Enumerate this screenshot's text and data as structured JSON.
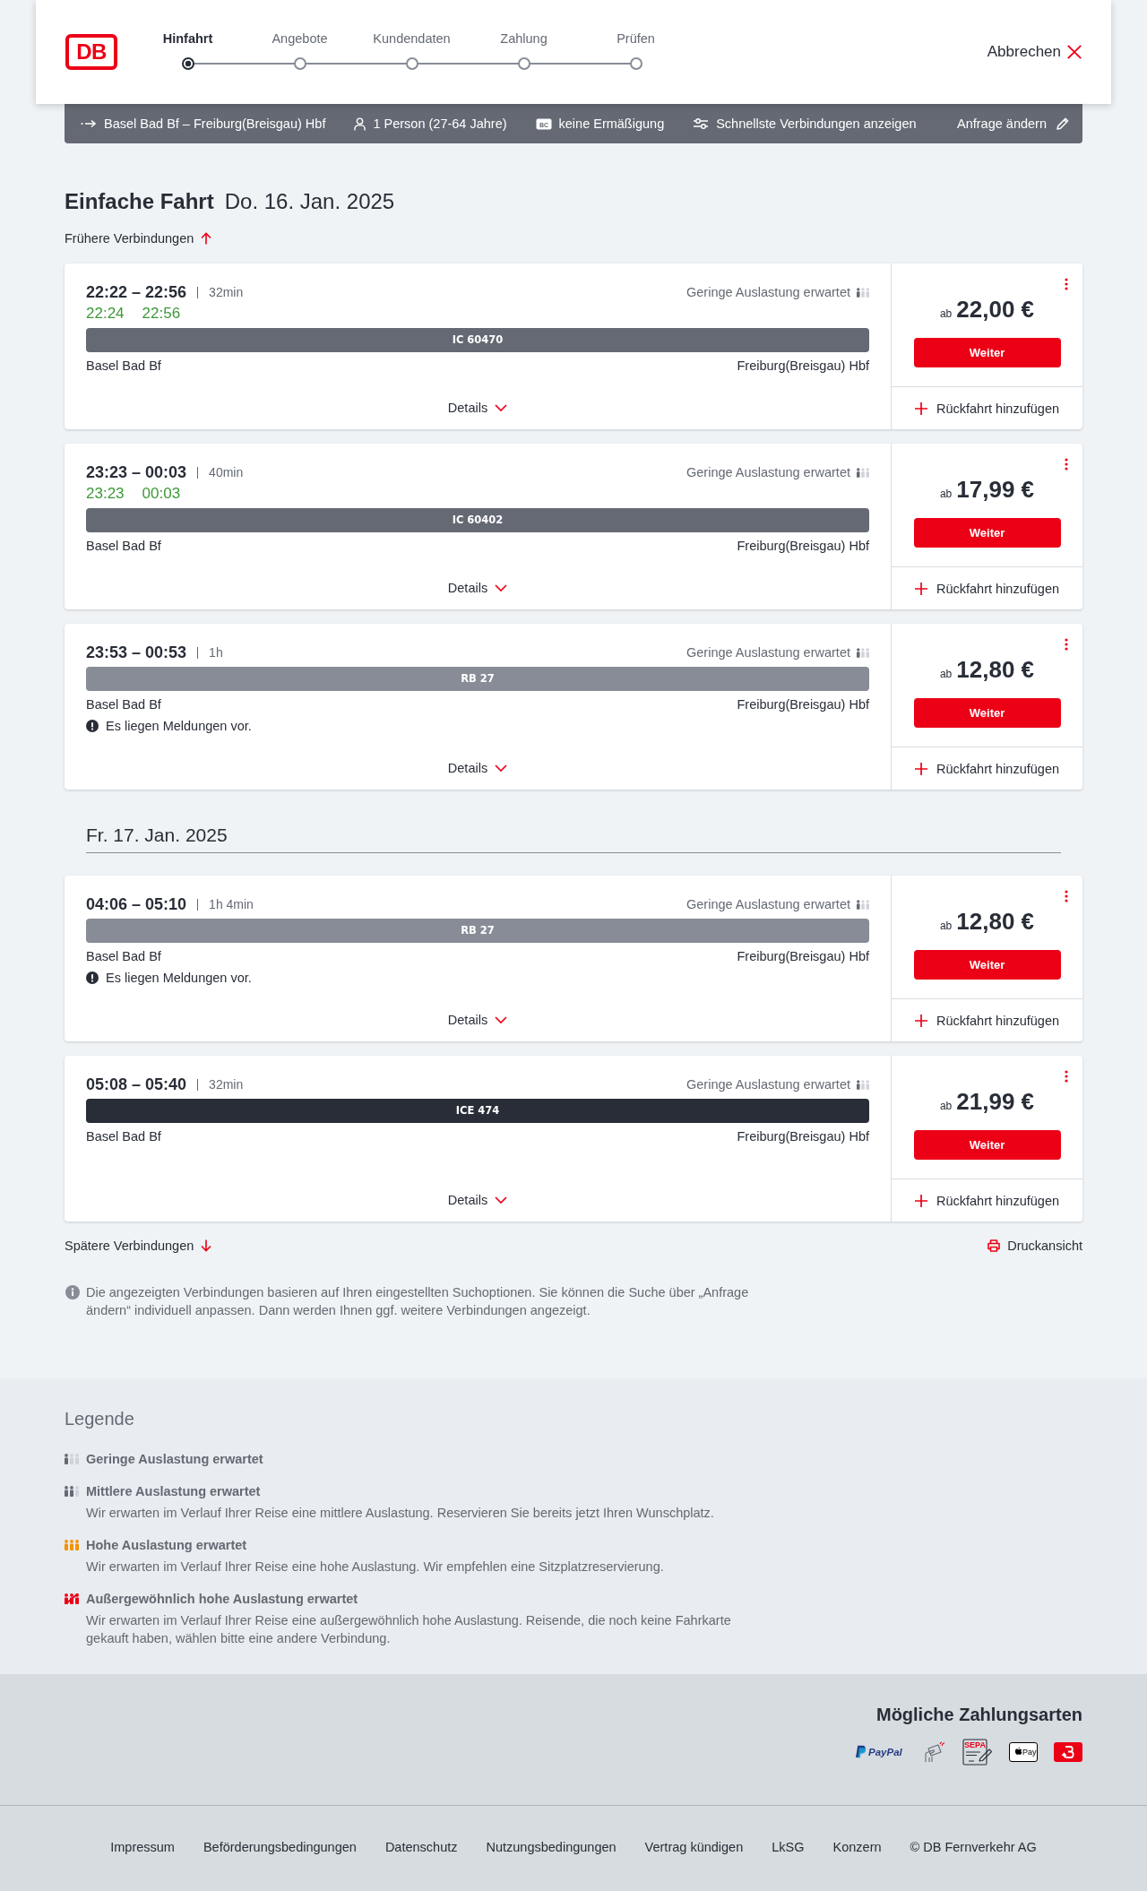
{
  "header": {
    "logo": "DB",
    "steps": [
      {
        "label": "Hinfahrt",
        "selected": true
      },
      {
        "label": "Angebote",
        "selected": false
      },
      {
        "label": "Kundendaten",
        "selected": false
      },
      {
        "label": "Zahlung",
        "selected": false
      },
      {
        "label": "Prüfen",
        "selected": false
      }
    ],
    "cancel": "Abbrechen"
  },
  "summary_bar": {
    "items": [
      {
        "kind": "route",
        "label": "Basel Bad Bf – Freiburg(Breisgau) Hbf"
      },
      {
        "kind": "person",
        "label": "1 Person (27-64 Jahre)"
      },
      {
        "kind": "card",
        "icon_label": "BC",
        "label": "keine Ermäßigung"
      },
      {
        "kind": "filter",
        "label": "Schnellste Verbindungen anzeigen"
      }
    ],
    "edit": "Anfrage ändern"
  },
  "title": {
    "trip_type": "Einfache Fahrt",
    "date": "Do. 16. Jan. 2025"
  },
  "earlier_link": "Frühere Verbindungen",
  "connection_groups": [
    {
      "connections": [
        {
          "times": "22:22 – 22:56",
          "duration": "32min",
          "realtime": {
            "departure": "22:24",
            "arrival": "22:56"
          },
          "occupancy": {
            "label": "Geringe Auslastung erwartet",
            "kind": "low"
          },
          "train": {
            "name": "IC 60470",
            "color": "#646973"
          },
          "from": "Basel Bad Bf",
          "to": "Freiburg(Breisgau) Hbf",
          "details": "Details",
          "price_prefix": "ab",
          "price": "22,00 €",
          "button": "Weiter",
          "return": "Rückfahrt hinzufügen"
        },
        {
          "times": "23:23 – 00:03",
          "duration": "40min",
          "realtime": {
            "departure": "23:23",
            "arrival": "00:03"
          },
          "occupancy": {
            "label": "Geringe Auslastung erwartet",
            "kind": "low"
          },
          "train": {
            "name": "IC 60402",
            "color": "#646973"
          },
          "from": "Basel Bad Bf",
          "to": "Freiburg(Breisgau) Hbf",
          "details": "Details",
          "price_prefix": "ab",
          "price": "17,99 €",
          "button": "Weiter",
          "return": "Rückfahrt hinzufügen"
        },
        {
          "times": "23:53 – 00:53",
          "duration": "1h",
          "occupancy": {
            "label": "Geringe Auslastung erwartet",
            "kind": "low"
          },
          "train": {
            "name": "RB 27",
            "color": "#878c96"
          },
          "from": "Basel Bad Bf",
          "to": "Freiburg(Breisgau) Hbf",
          "message": "Es liegen Meldungen vor.",
          "details": "Details",
          "price_prefix": "ab",
          "price": "12,80 €",
          "button": "Weiter",
          "return": "Rückfahrt hinzufügen"
        }
      ]
    },
    {
      "date": "Fr. 17. Jan. 2025",
      "connections": [
        {
          "times": "04:06 – 05:10",
          "duration": "1h 4min",
          "occupancy": {
            "label": "Geringe Auslastung erwartet",
            "kind": "low"
          },
          "train": {
            "name": "RB 27",
            "color": "#878c96"
          },
          "from": "Basel Bad Bf",
          "to": "Freiburg(Breisgau) Hbf",
          "message": "Es liegen Meldungen vor.",
          "details": "Details",
          "price_prefix": "ab",
          "price": "12,80 €",
          "button": "Weiter",
          "return": "Rückfahrt hinzufügen"
        },
        {
          "times": "05:08 – 05:40",
          "duration": "32min",
          "occupancy": {
            "label": "Geringe Auslastung erwartet",
            "kind": "low"
          },
          "train": {
            "name": "ICE 474",
            "color": "#282d37"
          },
          "from": "Basel Bad Bf",
          "to": "Freiburg(Breisgau) Hbf",
          "details": "Details",
          "price_prefix": "ab",
          "price": "21,99 €",
          "button": "Weiter",
          "return": "Rückfahrt hinzufügen"
        }
      ]
    }
  ],
  "later_link": "Spätere Verbindungen",
  "print_link": "Druckansicht",
  "info_note": "Die angezeigten Verbindungen basieren auf Ihren eingestellten Suchoptionen. Sie können die Suche über „Anfrage ändern“ individuell anpassen. Dann werden Ihnen ggf. weitere Verbindungen angezeigt.",
  "legend": {
    "title": "Legende",
    "items": [
      {
        "kind": "low",
        "title": "Geringe Auslastung erwartet"
      },
      {
        "kind": "medium",
        "title": "Mittlere Auslastung erwartet",
        "description": "Wir erwarten im Verlauf Ihrer Reise eine mittlere Auslastung. Reservieren Sie bereits jetzt Ihren Wunschplatz."
      },
      {
        "kind": "high",
        "title": "Hohe Auslastung erwartet",
        "description": "Wir erwarten im Verlauf Ihrer Reise eine hohe Auslastung. Wir empfehlen eine Sitzplatzreservierung."
      },
      {
        "kind": "exceptional",
        "title": "Außergewöhnlich hohe Auslastung erwartet",
        "description": "Wir erwarten im Verlauf Ihrer Reise eine außergewöhnlich hohe Auslastung. Reisende, die noch keine Fahrkarte gekauft haben, wählen bitte eine andere Verbindung."
      }
    ]
  },
  "payment": {
    "title": "Mögliche Zahlungsarten",
    "methods": [
      {
        "kind": "paypal",
        "label": "PayPal"
      },
      {
        "kind": "card"
      },
      {
        "kind": "sepa",
        "label": "SEPA"
      },
      {
        "kind": "applepay",
        "label": "Pay"
      },
      {
        "kind": "voucher"
      }
    ]
  },
  "footer_links": [
    "Impressum",
    "Beförderungsbedingungen",
    "Datenschutz",
    "Nutzungsbedingungen",
    "Vertrag kündigen",
    "LkSG",
    "Konzern",
    "© DB Fernverkehr AG"
  ]
}
